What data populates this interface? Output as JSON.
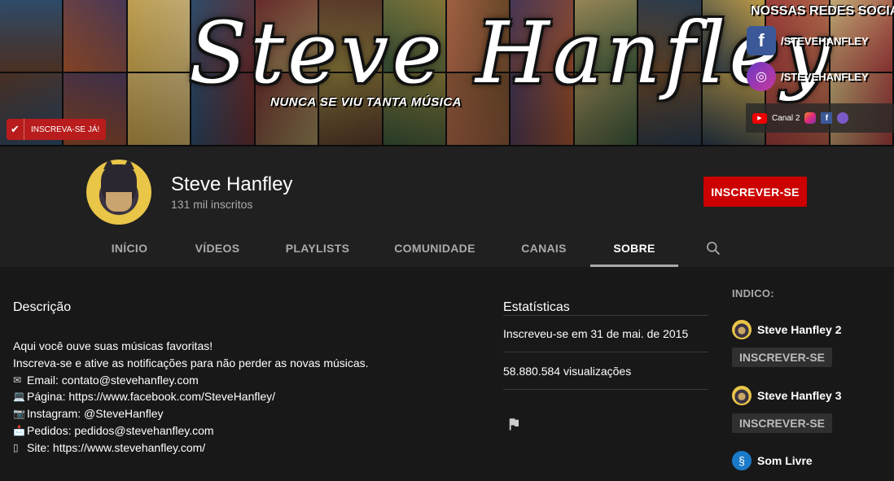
{
  "banner": {
    "logo_text": "Steve Hanfley",
    "tagline": "NUNCA SE VIU TANTA MÚSICA",
    "subscribe_label": "INSCREVA-SE JÁ!",
    "social_title": "NOSSAS REDES SOCIAIS:",
    "facebook_handle": "/STEVEHANFLEY",
    "instagram_handle": "/STEVEHANFLEY",
    "overlay_links_label": "Canal 2",
    "colors": [
      "#5b3b2c",
      "#a0522d",
      "#c7a34a",
      "#2f4f6f",
      "#6b2d2d",
      "#8a7a3a",
      "#3d5a3c",
      "#b56b4b",
      "#4b3a5a",
      "#9e8c5a",
      "#6d4a2a",
      "#2c3e50",
      "#a23b3b",
      "#c9b27a"
    ]
  },
  "channel": {
    "name": "Steve Hanfley",
    "subscribers": "131 mil inscritos",
    "subscribe_label": "INSCREVER-SE"
  },
  "tabs": [
    {
      "label": "INÍCIO",
      "active": false
    },
    {
      "label": "VÍDEOS",
      "active": false
    },
    {
      "label": "PLAYLISTS",
      "active": false
    },
    {
      "label": "COMUNIDADE",
      "active": false
    },
    {
      "label": "CANAIS",
      "active": false
    },
    {
      "label": "SOBRE",
      "active": true
    }
  ],
  "description": {
    "title": "Descrição",
    "lines": [
      {
        "icon": "",
        "text": "Aqui você ouve suas músicas favoritas!"
      },
      {
        "icon": "",
        "text": "Inscreva-se e ative as notificações para não perder as novas músicas."
      },
      {
        "icon": "✉",
        "text": "Email: contato@stevehanfley.com"
      },
      {
        "icon": "💻",
        "text": "Página: https://www.facebook.com/SteveHanfley/"
      },
      {
        "icon": "📷",
        "text": "Instagram: @SteveHanfley"
      },
      {
        "icon": "📩",
        "text": "Pedidos: pedidos@stevehanfley.com"
      },
      {
        "icon": "▯",
        "text": "Site: https://www.stevehanfley.com/"
      }
    ]
  },
  "stats": {
    "title": "Estatísticas",
    "joined": "Inscreveu-se em 31 de mai. de 2015",
    "views": "58.880.584 visualizações"
  },
  "sidebar": {
    "title": "INDICO:",
    "channels": [
      {
        "name": "Steve Hanfley 2",
        "subscribe_label": "INSCREVER-SE",
        "avatar": "steve-hanfley-avatar"
      },
      {
        "name": "Steve Hanfley 3",
        "subscribe_label": "INSCREVER-SE",
        "avatar": "steve-hanfley-avatar"
      },
      {
        "name": "Som Livre",
        "subscribe_label": "",
        "avatar": "som-livre-avatar"
      }
    ]
  }
}
